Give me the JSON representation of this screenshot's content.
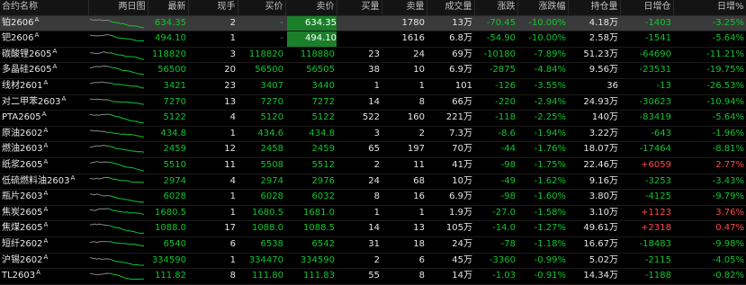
{
  "columns": [
    "合约名称",
    "两日图",
    "最新",
    "现手",
    "买价",
    "卖价",
    "买量",
    "卖量",
    "成交量",
    "涨跌",
    "涨跌幅",
    "持仓量",
    "日增仓",
    "日增%"
  ],
  "colors": {
    "up": "#ff4a4a",
    "down": "#11c52f",
    "neutral": "#e6e6e6",
    "limit_badge": "#1b7f2a"
  },
  "rows": [
    {
      "name": "铂2606",
      "sup": "A",
      "last": "634.35",
      "lot": "2",
      "bid": "-",
      "ask": "634.35",
      "bidvol": "",
      "askvol": "1780",
      "vol": "13万",
      "chg": "-70.45",
      "pct": "-10.00%",
      "oi": "4.18万",
      "oichg": "-1403",
      "oipct": "-3.25%",
      "dir": "down",
      "oidir": "down",
      "askbadge": true,
      "selected": true
    },
    {
      "name": "钯2606",
      "sup": "A",
      "last": "494.10",
      "lot": "1",
      "bid": "-",
      "ask": "494.10",
      "bidvol": "",
      "askvol": "1616",
      "vol": "6.8万",
      "chg": "-54.90",
      "pct": "-10.00%",
      "oi": "2.58万",
      "oichg": "-1541",
      "oipct": "-5.64%",
      "dir": "down",
      "oidir": "down",
      "askbadge": true
    },
    {
      "name": "碳酸锂2605",
      "sup": "A",
      "last": "118820",
      "lot": "3",
      "bid": "118820",
      "ask": "118880",
      "bidvol": "23",
      "askvol": "24",
      "vol": "69万",
      "chg": "-10180",
      "pct": "-7.89%",
      "oi": "51.23万",
      "oichg": "-64690",
      "oipct": "-11.21%",
      "dir": "down",
      "oidir": "down"
    },
    {
      "name": "多晶硅2605",
      "sup": "A",
      "last": "56500",
      "lot": "20",
      "bid": "56500",
      "ask": "56505",
      "bidvol": "38",
      "askvol": "10",
      "vol": "6.9万",
      "chg": "-2875",
      "pct": "-4.84%",
      "oi": "9.56万",
      "oichg": "-23531",
      "oipct": "-19.75%",
      "dir": "down",
      "oidir": "down"
    },
    {
      "name": "线材2601",
      "sup": "A",
      "last": "3421",
      "lot": "23",
      "bid": "3407",
      "ask": "3440",
      "bidvol": "1",
      "askvol": "1",
      "vol": "101",
      "chg": "-126",
      "pct": "-3.55%",
      "oi": "36",
      "oichg": "-13",
      "oipct": "-26.53%",
      "dir": "down",
      "oidir": "down"
    },
    {
      "name": "对二甲苯2603",
      "sup": "A",
      "last": "7270",
      "lot": "13",
      "bid": "7270",
      "ask": "7272",
      "bidvol": "14",
      "askvol": "8",
      "vol": "66万",
      "chg": "-220",
      "pct": "-2.94%",
      "oi": "24.93万",
      "oichg": "-30623",
      "oipct": "-10.94%",
      "dir": "down",
      "oidir": "down"
    },
    {
      "name": "PTA2605",
      "sup": "A",
      "last": "5122",
      "lot": "4",
      "bid": "5120",
      "ask": "5122",
      "bidvol": "522",
      "askvol": "160",
      "vol": "221万",
      "chg": "-118",
      "pct": "-2.25%",
      "oi": "140万",
      "oichg": "-83419",
      "oipct": "-5.64%",
      "dir": "down",
      "oidir": "down"
    },
    {
      "name": "原油2602",
      "sup": "A",
      "last": "434.8",
      "lot": "1",
      "bid": "434.6",
      "ask": "434.8",
      "bidvol": "3",
      "askvol": "2",
      "vol": "7.3万",
      "chg": "-8.6",
      "pct": "-1.94%",
      "oi": "3.22万",
      "oichg": "-643",
      "oipct": "-1.96%",
      "dir": "down",
      "oidir": "down"
    },
    {
      "name": "燃油2603",
      "sup": "A",
      "last": "2459",
      "lot": "12",
      "bid": "2458",
      "ask": "2459",
      "bidvol": "65",
      "askvol": "197",
      "vol": "70万",
      "chg": "-44",
      "pct": "-1.76%",
      "oi": "18.07万",
      "oichg": "-17464",
      "oipct": "-8.81%",
      "dir": "down",
      "oidir": "down"
    },
    {
      "name": "纸浆2605",
      "sup": "A",
      "last": "5510",
      "lot": "11",
      "bid": "5508",
      "ask": "5512",
      "bidvol": "2",
      "askvol": "11",
      "vol": "41万",
      "chg": "-98",
      "pct": "-1.75%",
      "oi": "22.46万",
      "oichg": "+6059",
      "oipct": "2.77%",
      "dir": "down",
      "oidir": "up"
    },
    {
      "name": "低硫燃料油2603",
      "sup": "A",
      "last": "2974",
      "lot": "4",
      "bid": "2974",
      "ask": "2976",
      "bidvol": "24",
      "askvol": "68",
      "vol": "10万",
      "chg": "-49",
      "pct": "-1.62%",
      "oi": "9.16万",
      "oichg": "-3253",
      "oipct": "-3.43%",
      "dir": "down",
      "oidir": "down"
    },
    {
      "name": "瓶片2603",
      "sup": "A",
      "last": "6028",
      "lot": "1",
      "bid": "6028",
      "ask": "6032",
      "bidvol": "8",
      "askvol": "16",
      "vol": "6.9万",
      "chg": "-98",
      "pct": "-1.60%",
      "oi": "3.80万",
      "oichg": "-4125",
      "oipct": "-9.79%",
      "dir": "down",
      "oidir": "down"
    },
    {
      "name": "焦炭2605",
      "sup": "A",
      "last": "1680.5",
      "lot": "1",
      "bid": "1680.5",
      "ask": "1681.0",
      "bidvol": "1",
      "askvol": "1",
      "vol": "1.9万",
      "chg": "-27.0",
      "pct": "-1.58%",
      "oi": "3.10万",
      "oichg": "+1123",
      "oipct": "3.76%",
      "dir": "down",
      "oidir": "up"
    },
    {
      "name": "焦煤2605",
      "sup": "A",
      "last": "1088.0",
      "lot": "17",
      "bid": "1088.0",
      "ask": "1088.5",
      "bidvol": "14",
      "askvol": "13",
      "vol": "105万",
      "chg": "-14.0",
      "pct": "-1.27%",
      "oi": "49.61万",
      "oichg": "+2318",
      "oipct": "0.47%",
      "dir": "down",
      "oidir": "up"
    },
    {
      "name": "短纤2602",
      "sup": "A",
      "last": "6540",
      "lot": "6",
      "bid": "6538",
      "ask": "6542",
      "bidvol": "31",
      "askvol": "18",
      "vol": "24万",
      "chg": "-78",
      "pct": "-1.18%",
      "oi": "16.67万",
      "oichg": "-18483",
      "oipct": "-9.98%",
      "dir": "down",
      "oidir": "down"
    },
    {
      "name": "沪锡2602",
      "sup": "A",
      "last": "334590",
      "lot": "1",
      "bid": "334470",
      "ask": "334590",
      "bidvol": "2",
      "askvol": "6",
      "vol": "45万",
      "chg": "-3360",
      "pct": "-0.99%",
      "oi": "5.02万",
      "oichg": "-2115",
      "oipct": "-4.05%",
      "dir": "down",
      "oidir": "down"
    },
    {
      "name": "TL2603",
      "sup": "A",
      "last": "111.82",
      "lot": "8",
      "bid": "111.80",
      "ask": "111.83",
      "bidvol": "55",
      "askvol": "8",
      "vol": "14万",
      "chg": "-1.03",
      "pct": "-0.91%",
      "oi": "14.34万",
      "oichg": "-1188",
      "oipct": "-0.82%",
      "dir": "down",
      "oidir": "down"
    }
  ]
}
